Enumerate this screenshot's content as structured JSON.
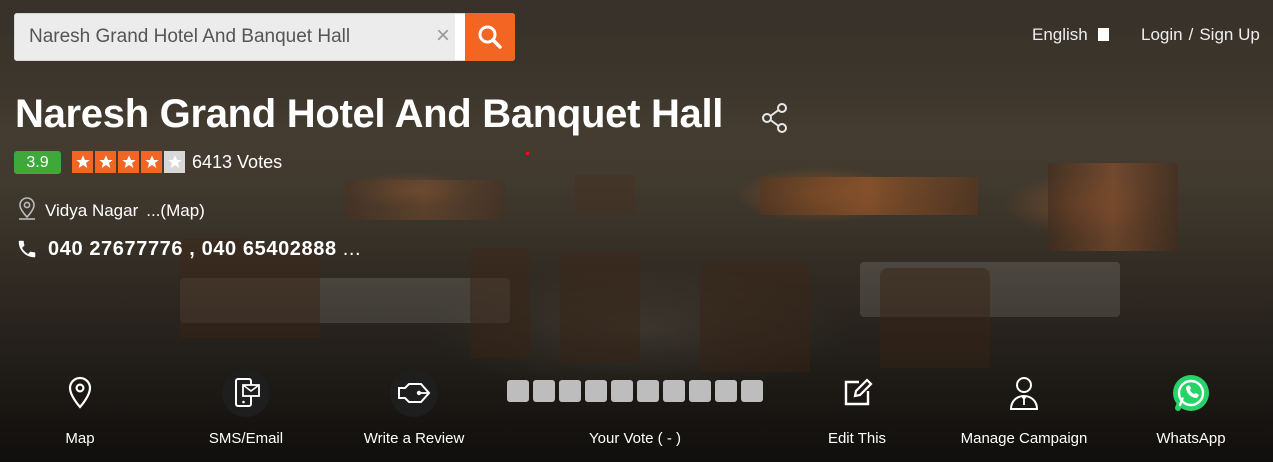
{
  "search": {
    "value": "Naresh Grand Hotel And Banquet Hall",
    "clear_glyph": "×",
    "search_icon": "search-icon"
  },
  "header": {
    "language": "English",
    "login": "Login",
    "separator": "/",
    "signup": "Sign Up"
  },
  "business": {
    "name": "Naresh Grand Hotel And Banquet Hall",
    "rating": "3.9",
    "stars_filled": 4,
    "stars_total": 5,
    "votes": "6413 Votes",
    "address": "Vidya Nagar",
    "map_link": "...(Map)",
    "phones": "040 27677776 , 040 65402888",
    "phones_more": "..."
  },
  "actions": {
    "map": "Map",
    "sms_email": "SMS/Email",
    "write_review": "Write a Review",
    "your_vote": "Your Vote ( - )",
    "edit_this": "Edit This",
    "manage_campaign": "Manage Campaign",
    "whatsapp": "WhatsApp"
  },
  "colors": {
    "accent": "#f26522",
    "rating_green": "#3fa83a",
    "whatsapp_green": "#25d366"
  }
}
